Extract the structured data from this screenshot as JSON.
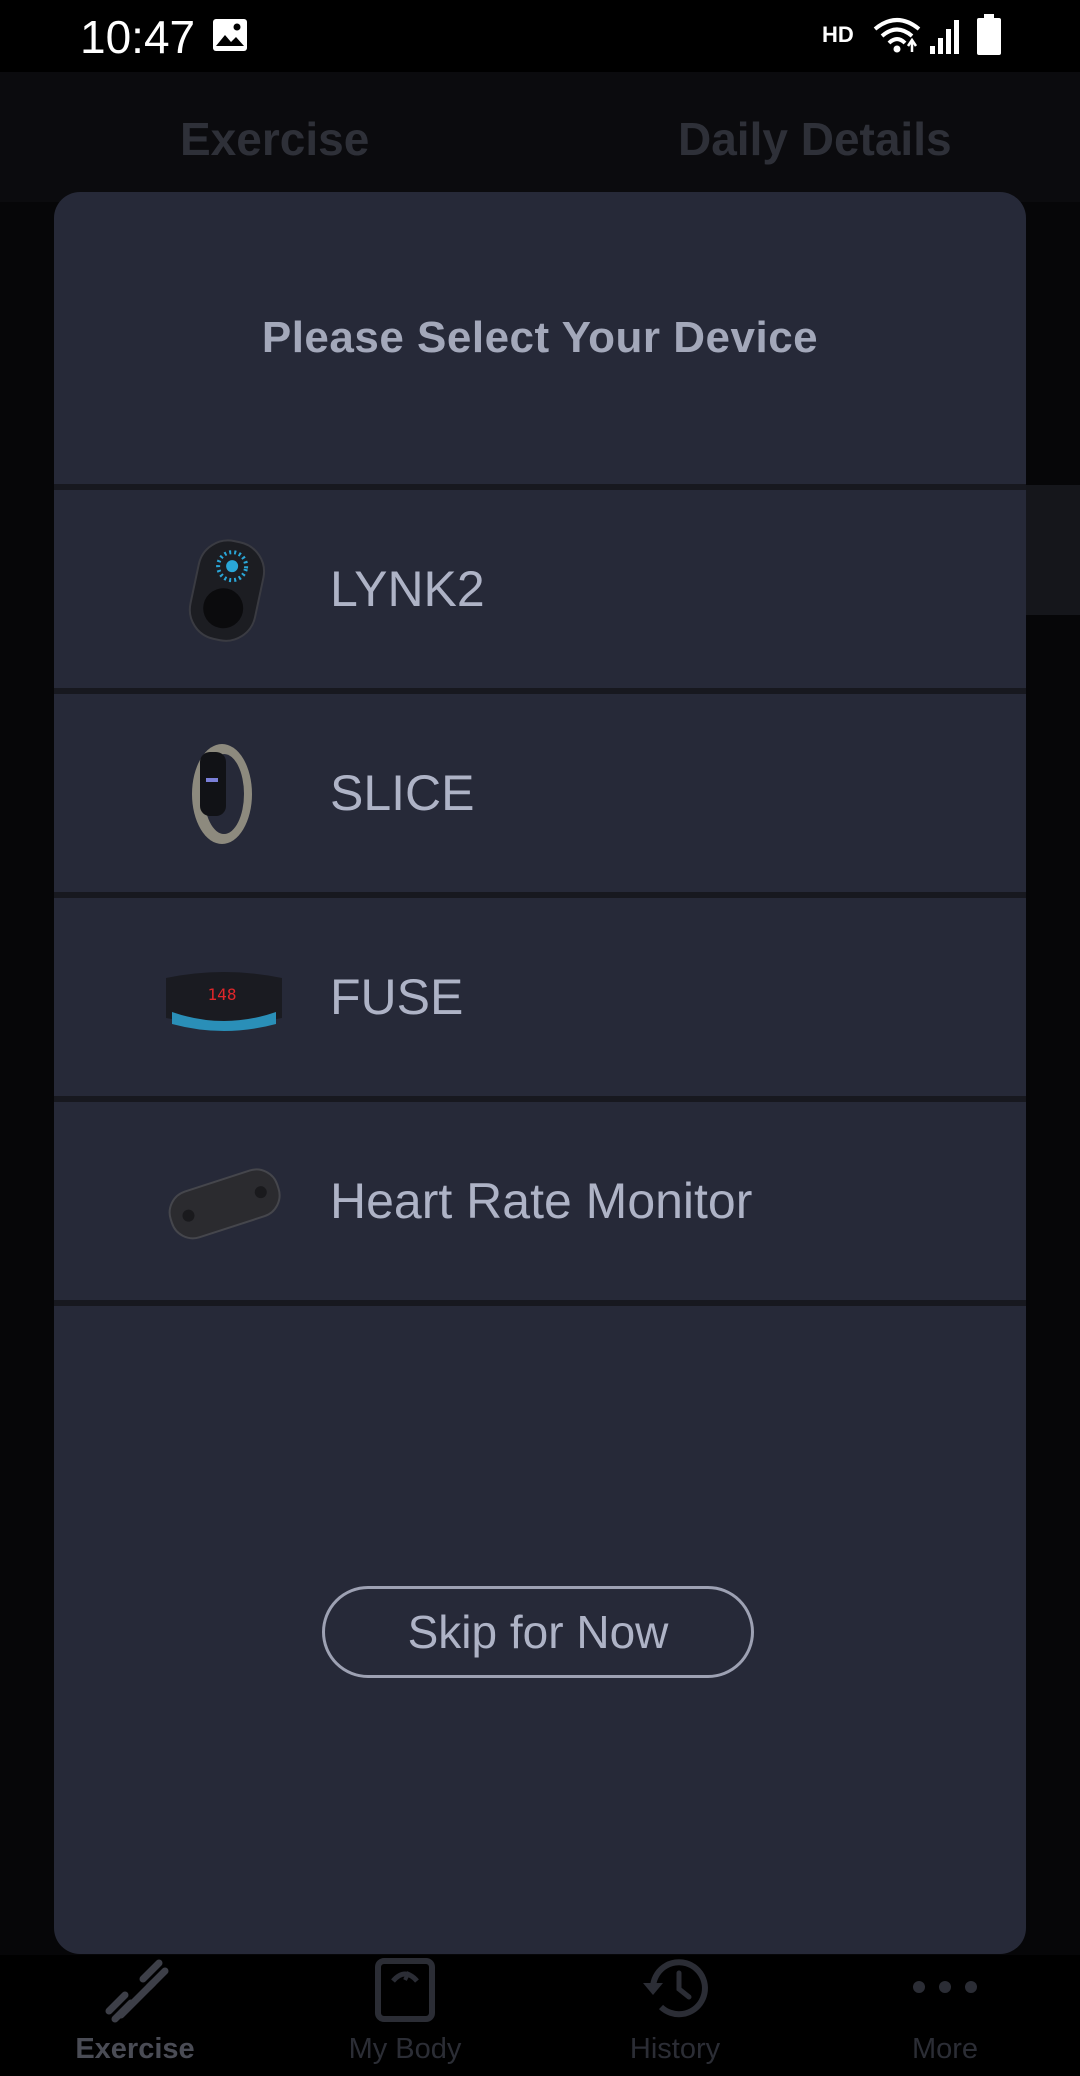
{
  "status_bar": {
    "time": "10:47",
    "network_label": "HD",
    "icons": [
      "gallery-icon",
      "wifi-icon",
      "signal-icon",
      "battery-icon"
    ]
  },
  "background_app": {
    "tabs": [
      {
        "label": "Exercise"
      },
      {
        "label": "Daily Details"
      }
    ]
  },
  "dialog": {
    "title": "Please Select Your Device",
    "devices": [
      {
        "label": "LYNK2",
        "icon": "lynk2-device-icon"
      },
      {
        "label": "SLICE",
        "icon": "slice-device-icon"
      },
      {
        "label": "FUSE",
        "icon": "fuse-device-icon"
      },
      {
        "label": "Heart Rate Monitor",
        "icon": "heart-rate-monitor-icon"
      }
    ],
    "skip_label": "Skip for Now",
    "fuse_display_text": "148"
  },
  "bottom_nav": {
    "items": [
      {
        "label": "Exercise",
        "icon": "dumbbell-icon",
        "active": true
      },
      {
        "label": "My Body",
        "icon": "scale-icon",
        "active": false
      },
      {
        "label": "History",
        "icon": "history-icon",
        "active": false
      },
      {
        "label": "More",
        "icon": "more-dots-icon",
        "active": false
      }
    ]
  },
  "colors": {
    "dialog_bg": "#262938",
    "text": "#aeb3c6",
    "divider": "#17181f",
    "accent_blue": "#2aa7d8",
    "fuse_red": "#e0262a"
  }
}
